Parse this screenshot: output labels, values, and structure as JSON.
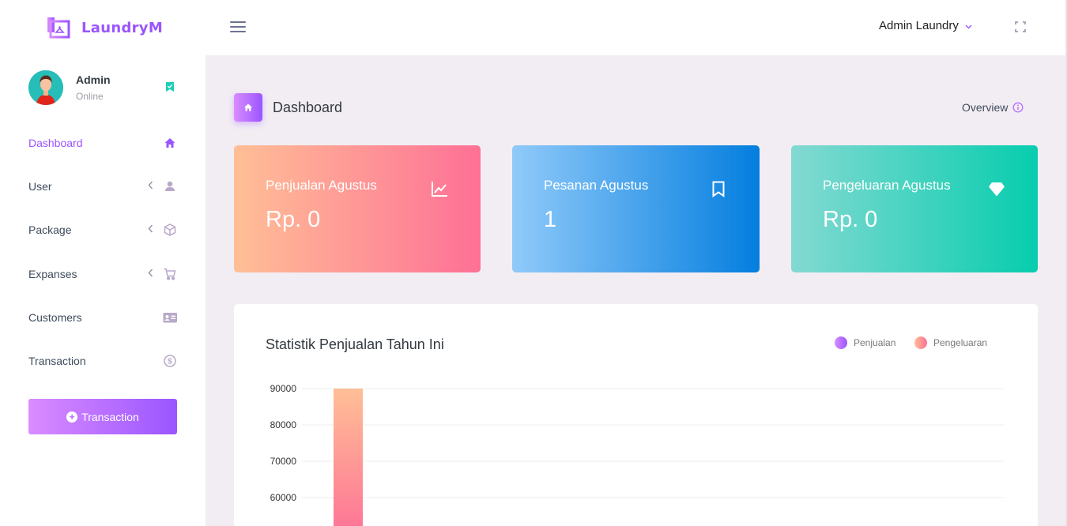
{
  "app": {
    "brand": "LaundryM"
  },
  "header": {
    "user_menu_label": "Admin Laundry"
  },
  "profile": {
    "name": "Admin",
    "status": "Online"
  },
  "sidebar": {
    "items": [
      {
        "label": "Dashboard",
        "icon": "home-icon",
        "active": true,
        "has_arrow": false
      },
      {
        "label": "User",
        "icon": "user-icon",
        "active": false,
        "has_arrow": true
      },
      {
        "label": "Package",
        "icon": "package-icon",
        "active": false,
        "has_arrow": true
      },
      {
        "label": "Expanses",
        "icon": "cart-icon",
        "active": false,
        "has_arrow": true
      },
      {
        "label": "Customers",
        "icon": "id-card-icon",
        "active": false,
        "has_arrow": false
      },
      {
        "label": "Transaction",
        "icon": "dollar-icon",
        "active": false,
        "has_arrow": false
      }
    ],
    "transaction_button": "Transaction"
  },
  "page": {
    "title": "Dashboard",
    "overview": "Overview"
  },
  "cards": [
    {
      "label": "Penjualan Agustus",
      "value": "Rp. 0",
      "icon": "line-chart-icon"
    },
    {
      "label": "Pesanan Agustus",
      "value": "1",
      "icon": "bookmark-icon"
    },
    {
      "label": "Pengeluaran Agustus",
      "value": "Rp. 0",
      "icon": "diamond-icon"
    }
  ],
  "colors": {
    "accent": "#9a55ff",
    "card1": [
      "#ffbf96",
      "#fe7096"
    ],
    "card2": [
      "#90caf9",
      "#047edf"
    ],
    "card3": [
      "#84d9d2",
      "#07cdae"
    ]
  },
  "chart_data": {
    "type": "bar",
    "title": "Statistik Penjualan Tahun Ini",
    "legend_position": "top-right",
    "grid": true,
    "y_ticks": [
      90000,
      80000,
      70000,
      60000
    ],
    "series": [
      {
        "name": "Penjualan",
        "colors": [
          "#da8cff",
          "#9a55ff"
        ],
        "values": [
          90000
        ]
      },
      {
        "name": "Pengeluaran",
        "colors": [
          "#ffbf96",
          "#fe7096"
        ],
        "values": []
      }
    ],
    "visible_bar": {
      "series": "Penjualan",
      "value": 90000
    }
  }
}
